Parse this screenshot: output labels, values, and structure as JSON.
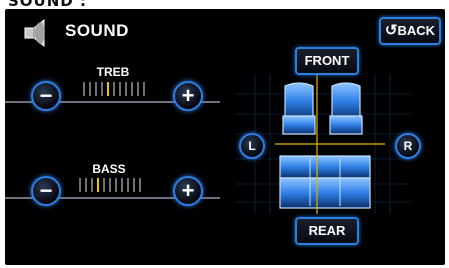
{
  "header": {
    "cropped_title": "SOUND :",
    "title": "SOUND"
  },
  "buttons": {
    "back": "BACK",
    "front": "FRONT",
    "rear": "REAR",
    "left": "L",
    "right": "R"
  },
  "treble": {
    "label": "TREB",
    "minus": "−",
    "plus": "+",
    "level_index": 4,
    "segments": 11
  },
  "bass": {
    "label": "BASS",
    "minus": "−",
    "plus": "+",
    "level_index": 3,
    "segments": 11
  },
  "icons": [
    "speaker-icon",
    "back-arrow-icon",
    "seat-icon"
  ],
  "colors": {
    "accent": "#2b7fe0",
    "level": "#f2c400",
    "crosshair": "#e1b400"
  }
}
